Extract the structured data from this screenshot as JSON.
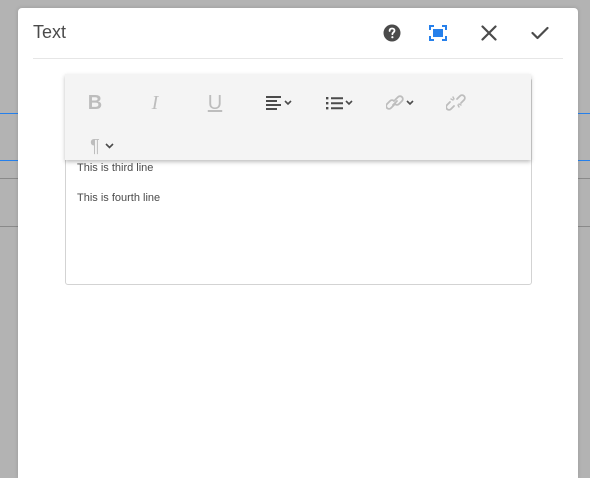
{
  "dialog": {
    "title": "Text",
    "actions": [
      {
        "name": "help-icon"
      },
      {
        "name": "fullscreen-icon"
      },
      {
        "name": "close-icon"
      },
      {
        "name": "check-icon"
      }
    ]
  },
  "toolbar": {
    "bold_label": "B",
    "italic_label": "I",
    "underline_label": "U",
    "paragraph_label": "¶",
    "icons": [
      "justify-dropdown-icon",
      "list-dropdown-icon",
      "link-icon",
      "unlink-icon",
      "paragraph-format-icon"
    ]
  },
  "editor": {
    "lines": [
      "This is third line",
      "This is fourth line"
    ]
  },
  "colors": {
    "accent": "#2680eb",
    "toolbar_bg": "#f4f4f4",
    "disabled_icon": "#bdbdbd",
    "active_icon": "#4b4b4b",
    "backdrop": "#b3b3b3"
  }
}
